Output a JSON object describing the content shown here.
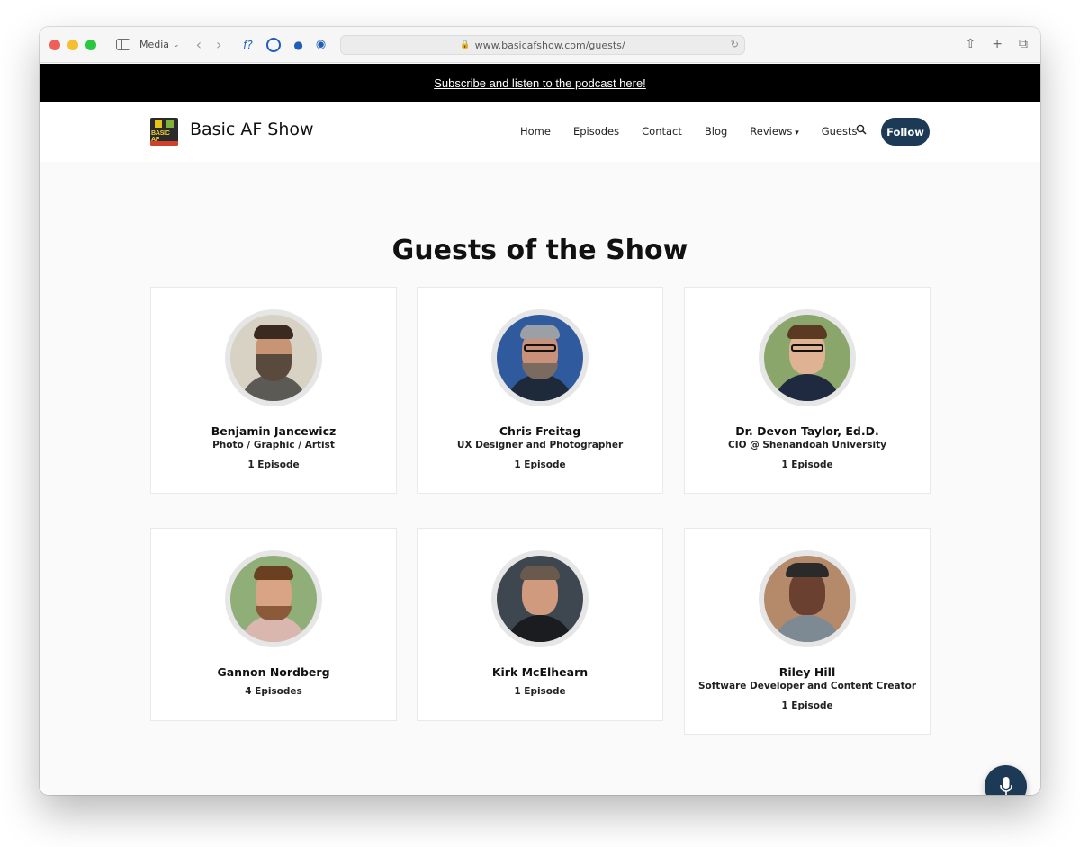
{
  "browser": {
    "sidebar_label": "Media",
    "url": "www.basicafshow.com/guests/"
  },
  "banner": {
    "link_text": "Subscribe and listen to the podcast here!"
  },
  "header": {
    "site_title": "Basic AF Show",
    "logo_text": "BASIC AF",
    "nav": [
      "Home",
      "Episodes",
      "Contact",
      "Blog",
      "Reviews",
      "Guests"
    ],
    "follow_label": "Follow"
  },
  "main": {
    "title": "Guests of the Show",
    "guests": [
      {
        "name": "Benjamin Jancewicz",
        "role": "Photo / Graphic / Artist",
        "episodes": "1 Episode"
      },
      {
        "name": "Chris Freitag",
        "role": "UX Designer and Photographer",
        "episodes": "1 Episode"
      },
      {
        "name": "Dr. Devon Taylor, Ed.D.",
        "role": "CIO @ Shenandoah University",
        "episodes": "1 Episode"
      },
      {
        "name": "Gannon Nordberg",
        "role": "",
        "episodes": "4 Episodes"
      },
      {
        "name": "Kirk McElhearn",
        "role": "",
        "episodes": "1 Episode"
      },
      {
        "name": "Riley Hill",
        "role": "Software Developer and Content Creator",
        "episodes": "1 Episode"
      }
    ]
  },
  "colors": {
    "accent": "#1c3a56",
    "banner_bg": "#000000",
    "page_bg": "#fafafa"
  },
  "icons": {
    "search": "search-icon",
    "mic": "microphone-icon"
  }
}
